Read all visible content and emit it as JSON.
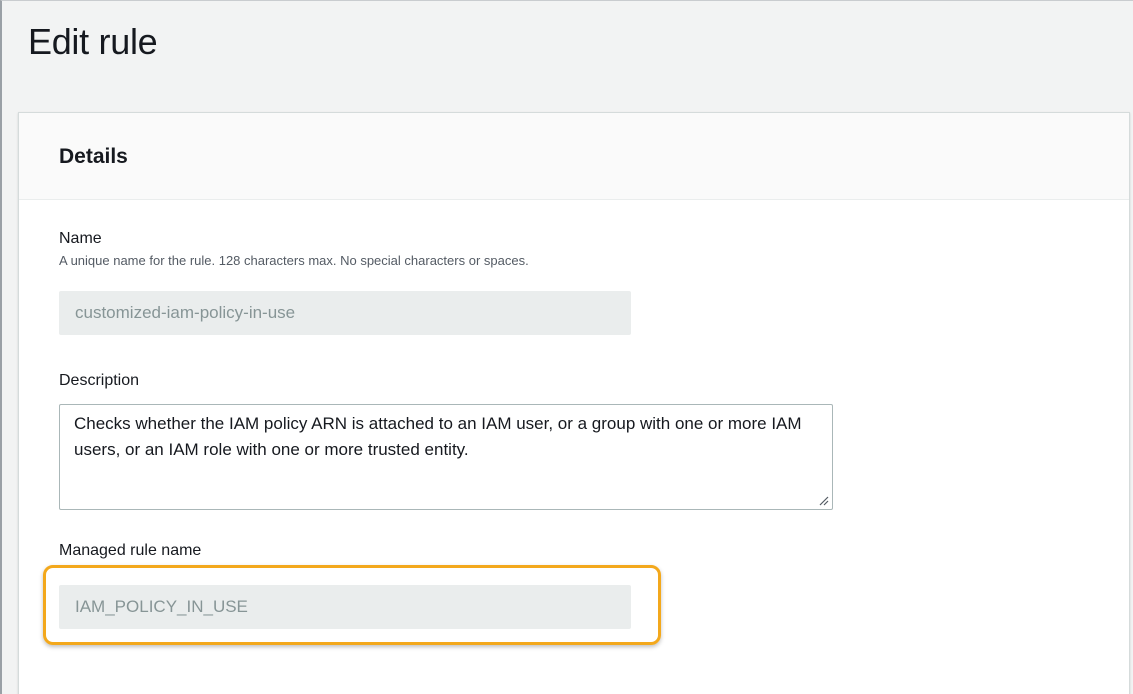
{
  "page": {
    "title": "Edit rule"
  },
  "details": {
    "header": "Details",
    "name": {
      "label": "Name",
      "hint": "A unique name for the rule. 128 characters max. No special characters or spaces.",
      "value": "customized-iam-policy-in-use"
    },
    "description": {
      "label": "Description",
      "value": "Checks whether the IAM policy ARN is attached to an IAM user, or a group with one or more IAM users, or an IAM role with one or more trusted entity."
    },
    "managed_rule": {
      "label": "Managed rule name",
      "value": "IAM_POLICY_IN_USE"
    }
  },
  "colors": {
    "highlight": "#f3a81c",
    "readonly_bg": "#eaeded",
    "page_bg": "#f2f3f3"
  },
  "icons": {
    "textarea_resize": "resize-grip-icon"
  }
}
